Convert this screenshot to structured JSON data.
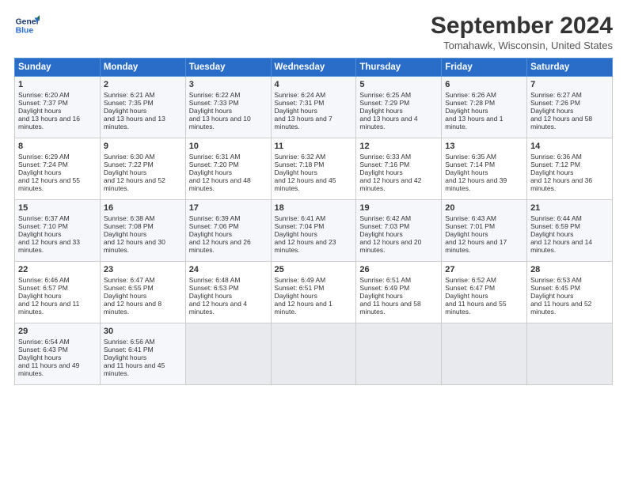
{
  "logo": {
    "line1": "General",
    "line2": "Blue"
  },
  "title": "September 2024",
  "location": "Tomahawk, Wisconsin, United States",
  "days_of_week": [
    "Sunday",
    "Monday",
    "Tuesday",
    "Wednesday",
    "Thursday",
    "Friday",
    "Saturday"
  ],
  "weeks": [
    [
      {
        "day": "1",
        "sunrise": "6:20 AM",
        "sunset": "7:37 PM",
        "daylight": "13 hours and 16 minutes."
      },
      {
        "day": "2",
        "sunrise": "6:21 AM",
        "sunset": "7:35 PM",
        "daylight": "13 hours and 13 minutes."
      },
      {
        "day": "3",
        "sunrise": "6:22 AM",
        "sunset": "7:33 PM",
        "daylight": "13 hours and 10 minutes."
      },
      {
        "day": "4",
        "sunrise": "6:24 AM",
        "sunset": "7:31 PM",
        "daylight": "13 hours and 7 minutes."
      },
      {
        "day": "5",
        "sunrise": "6:25 AM",
        "sunset": "7:29 PM",
        "daylight": "13 hours and 4 minutes."
      },
      {
        "day": "6",
        "sunrise": "6:26 AM",
        "sunset": "7:28 PM",
        "daylight": "13 hours and 1 minute."
      },
      {
        "day": "7",
        "sunrise": "6:27 AM",
        "sunset": "7:26 PM",
        "daylight": "12 hours and 58 minutes."
      }
    ],
    [
      {
        "day": "8",
        "sunrise": "6:29 AM",
        "sunset": "7:24 PM",
        "daylight": "12 hours and 55 minutes."
      },
      {
        "day": "9",
        "sunrise": "6:30 AM",
        "sunset": "7:22 PM",
        "daylight": "12 hours and 52 minutes."
      },
      {
        "day": "10",
        "sunrise": "6:31 AM",
        "sunset": "7:20 PM",
        "daylight": "12 hours and 48 minutes."
      },
      {
        "day": "11",
        "sunrise": "6:32 AM",
        "sunset": "7:18 PM",
        "daylight": "12 hours and 45 minutes."
      },
      {
        "day": "12",
        "sunrise": "6:33 AM",
        "sunset": "7:16 PM",
        "daylight": "12 hours and 42 minutes."
      },
      {
        "day": "13",
        "sunrise": "6:35 AM",
        "sunset": "7:14 PM",
        "daylight": "12 hours and 39 minutes."
      },
      {
        "day": "14",
        "sunrise": "6:36 AM",
        "sunset": "7:12 PM",
        "daylight": "12 hours and 36 minutes."
      }
    ],
    [
      {
        "day": "15",
        "sunrise": "6:37 AM",
        "sunset": "7:10 PM",
        "daylight": "12 hours and 33 minutes."
      },
      {
        "day": "16",
        "sunrise": "6:38 AM",
        "sunset": "7:08 PM",
        "daylight": "12 hours and 30 minutes."
      },
      {
        "day": "17",
        "sunrise": "6:39 AM",
        "sunset": "7:06 PM",
        "daylight": "12 hours and 26 minutes."
      },
      {
        "day": "18",
        "sunrise": "6:41 AM",
        "sunset": "7:04 PM",
        "daylight": "12 hours and 23 minutes."
      },
      {
        "day": "19",
        "sunrise": "6:42 AM",
        "sunset": "7:03 PM",
        "daylight": "12 hours and 20 minutes."
      },
      {
        "day": "20",
        "sunrise": "6:43 AM",
        "sunset": "7:01 PM",
        "daylight": "12 hours and 17 minutes."
      },
      {
        "day": "21",
        "sunrise": "6:44 AM",
        "sunset": "6:59 PM",
        "daylight": "12 hours and 14 minutes."
      }
    ],
    [
      {
        "day": "22",
        "sunrise": "6:46 AM",
        "sunset": "6:57 PM",
        "daylight": "12 hours and 11 minutes."
      },
      {
        "day": "23",
        "sunrise": "6:47 AM",
        "sunset": "6:55 PM",
        "daylight": "12 hours and 8 minutes."
      },
      {
        "day": "24",
        "sunrise": "6:48 AM",
        "sunset": "6:53 PM",
        "daylight": "12 hours and 4 minutes."
      },
      {
        "day": "25",
        "sunrise": "6:49 AM",
        "sunset": "6:51 PM",
        "daylight": "12 hours and 1 minute."
      },
      {
        "day": "26",
        "sunrise": "6:51 AM",
        "sunset": "6:49 PM",
        "daylight": "11 hours and 58 minutes."
      },
      {
        "day": "27",
        "sunrise": "6:52 AM",
        "sunset": "6:47 PM",
        "daylight": "11 hours and 55 minutes."
      },
      {
        "day": "28",
        "sunrise": "6:53 AM",
        "sunset": "6:45 PM",
        "daylight": "11 hours and 52 minutes."
      }
    ],
    [
      {
        "day": "29",
        "sunrise": "6:54 AM",
        "sunset": "6:43 PM",
        "daylight": "11 hours and 49 minutes."
      },
      {
        "day": "30",
        "sunrise": "6:56 AM",
        "sunset": "6:41 PM",
        "daylight": "11 hours and 45 minutes."
      },
      null,
      null,
      null,
      null,
      null
    ]
  ]
}
